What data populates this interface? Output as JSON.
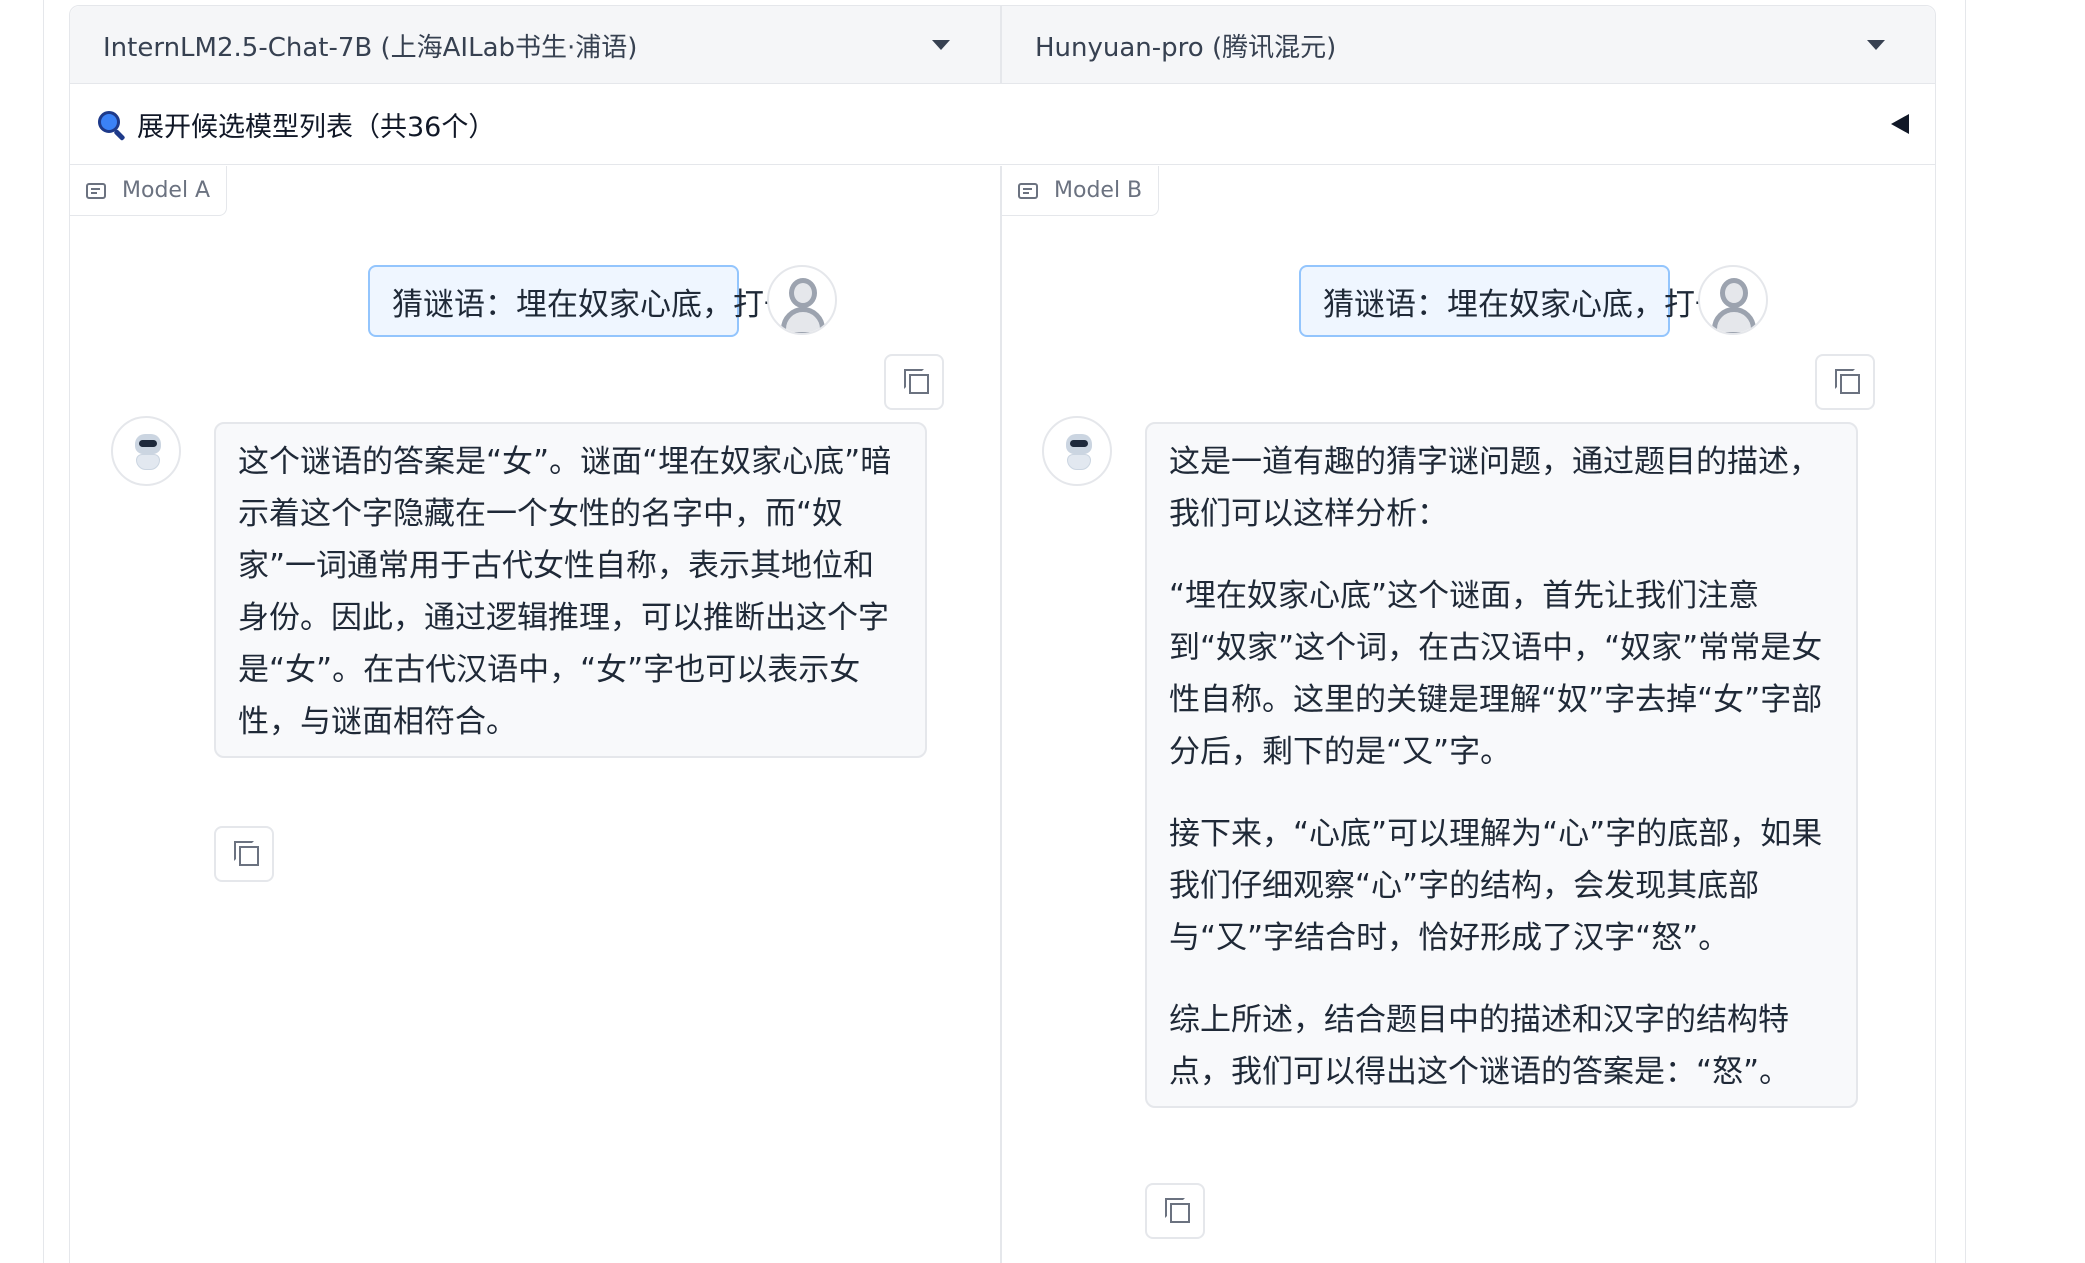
{
  "model_select": {
    "model_a": "InternLM2.5-Chat-7B (上海AILab书生·浦语)",
    "model_b": "Hunyuan-pro (腾讯混元)"
  },
  "expander": {
    "label": "展开候选模型列表（共36个）"
  },
  "panel_a": {
    "label": "Model A",
    "user_message": "猜谜语：埋在奴家心底，打一字",
    "bot_paragraphs": [
      "这个谜语的答案是“女”。谜面“埋在奴家心底”暗示着这个字隐藏在一个女性的名字中，而“奴家”一词通常用于古代女性自称，表示其地位和身份。因此，通过逻辑推理，可以推断出这个字是“女”。在古代汉语中，“女”字也可以表示女性，与谜面相符合。"
    ]
  },
  "panel_b": {
    "label": "Model B",
    "user_message": "猜谜语：埋在奴家心底，打一字",
    "bot_paragraphs": [
      "这是一道有趣的猜字谜问题，通过题目的描述，我们可以这样分析：",
      "“埋在奴家心底”这个谜面，首先让我们注意到“奴家”这个词，在古汉语中，“奴家”常常是女性自称。这里的关键是理解“奴”字去掉“女”字部分后，剩下的是“又”字。",
      "接下来，“心底”可以理解为“心”字的底部，如果我们仔细观察“心”字的结构，会发现其底部与“又”字结合时，恰好形成了汉字“怒”。",
      "综上所述，结合题目中的描述和汉字的结构特点，我们可以得出这个谜语的答案是：“怒”。"
    ]
  },
  "icons": {
    "select_caret": "caret-down-icon",
    "expander": "magnifier-icon",
    "collapse": "triangle-left-icon",
    "panel_label": "chat-icon",
    "user_avatar": "user-avatar-icon",
    "bot_avatar": "robot-avatar-icon",
    "copy": "copy-icon"
  },
  "colors": {
    "user_bubble_border": "#93c5fd",
    "user_bubble_bg": "#eff6ff",
    "bot_bubble_bg": "#f8f9fb",
    "border": "#e5e7eb",
    "magnifier": "#3b82f6"
  }
}
